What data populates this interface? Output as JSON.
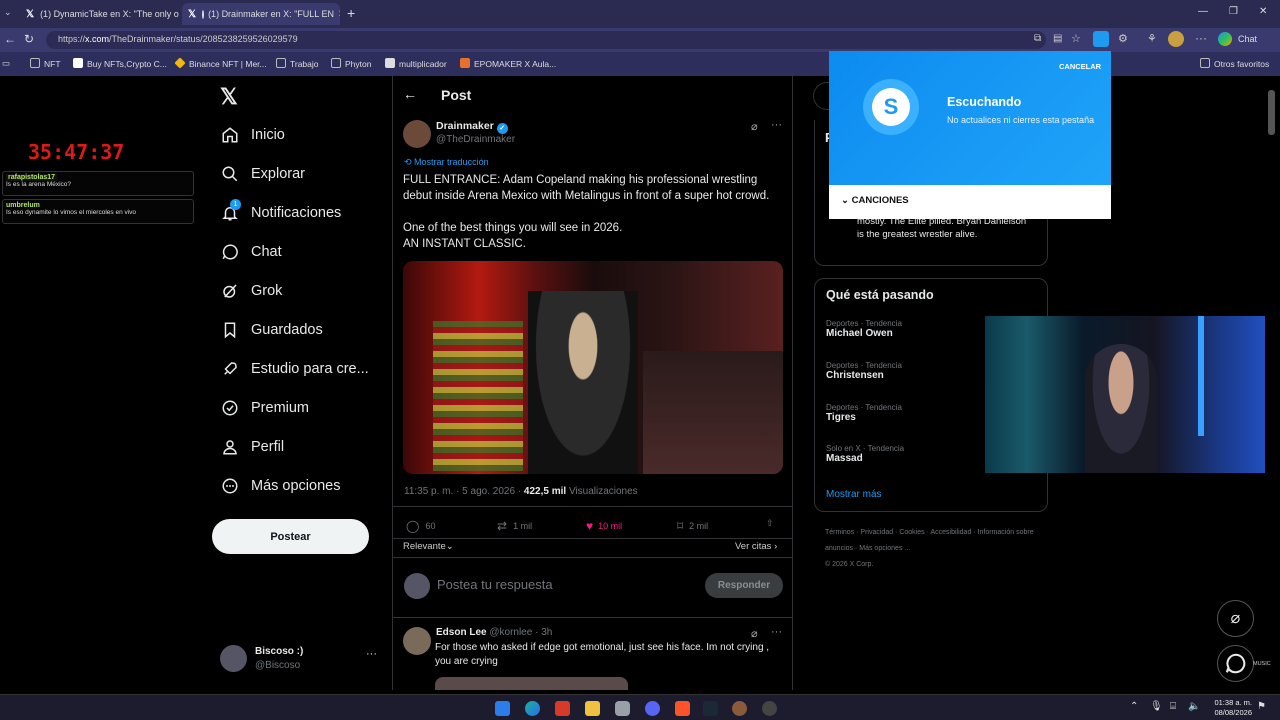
{
  "browser": {
    "tabs": [
      {
        "label": "(1) DynamicTake en X: \"The only o"
      },
      {
        "label": "(1) Drainmaker en X: \"FULL EN"
      }
    ],
    "url_prefix": "https://",
    "url_domain": "x.com",
    "url_path": "/TheDrainmaker/status/2085238259526029579",
    "chat_label": "Chat",
    "bookmarks": [
      "NFT",
      "Buy NFTs,Crypto C...",
      "Binance NFT | Mer...",
      "Trabajo",
      "Phyton",
      "multiplicador",
      "EPOMAKER X Aula..."
    ],
    "other_bookmarks": "Otros favoritos"
  },
  "overlay": {
    "timer": "35:47:37",
    "chat": [
      {
        "user": "rafapistolas17",
        "msg": "Is es la arena México?"
      },
      {
        "user": "umbrelum",
        "msg": "Is eso dynamite lo vimos el miercoles en vivo"
      }
    ]
  },
  "nav": {
    "items": [
      "Inicio",
      "Explorar",
      "Notificaciones",
      "Chat",
      "Grok",
      "Guardados",
      "Estudio para cre...",
      "Premium",
      "Perfil",
      "Más opciones"
    ],
    "notif_count": "1",
    "post_button": "Postear",
    "account_name": "Biscoso :)",
    "account_handle": "@Biscoso"
  },
  "post": {
    "header": "Post",
    "author": "Drainmaker",
    "handle": "@TheDrainmaker",
    "translate": "Mostrar traducción",
    "text1": "FULL ENTRANCE: Adam Copeland making his professional wrestling debut inside Arena Mexico with Metalingus in front of a super hot crowd.",
    "text2": "One of the best things you will see in 2026.",
    "text3": "AN INSTANT CLASSIC.",
    "timestamp": "11:35 p. m. · 5 ago. 2026 ·",
    "views_count": "422,5 mil",
    "views_label": "Visualizaciones",
    "replies": "60",
    "reposts": "1 mil",
    "likes": "10 mil",
    "bookmarks": "2 mil",
    "sort": "Relevante",
    "quotes": "Ver citas",
    "reply_placeholder": "Postea tu respuesta",
    "reply_button": "Responder"
  },
  "reply": {
    "author": "Edson Lee",
    "handle": "@kornlee",
    "time": "· 3h",
    "text": "For those who asked if edge got emotional, just see his face. Im not crying , you are crying"
  },
  "sidebar": {
    "snippet": "mostly. The Elite pilled. Bryan Danielson is the greatest wrestler alive.",
    "trends_title": "Qué está pasando",
    "trends": [
      {
        "category": "Deportes · Tendencia",
        "name": "Michael Owen"
      },
      {
        "category": "Deportes · Tendencia",
        "name": "Christensen"
      },
      {
        "category": "Deportes · Tendencia",
        "name": "Tigres"
      },
      {
        "category": "Solo en X · Tendencia",
        "name": "Massad"
      }
    ],
    "show_more": "Mostrar más",
    "footer_links": [
      "Términos",
      "Privacidad",
      "Cookies",
      "Accesibilidad",
      "Información sobre anuncios",
      "Más opciones ..."
    ],
    "copyright": "© 2026 X Corp."
  },
  "shazam": {
    "cancel": "CANCELAR",
    "title": "Escuchando",
    "subtitle": "No actualices ni cierres esta pestaña",
    "songs": "CANCIONES"
  },
  "taskbar": {
    "time": "01:38 a. m.",
    "date": "08/08/2026",
    "music_label": "MUSIC"
  },
  "colors": {
    "accent": "#1d9bf0",
    "like": "#f91880",
    "timer": "#e01818",
    "shazam": "#0d8bf0"
  }
}
